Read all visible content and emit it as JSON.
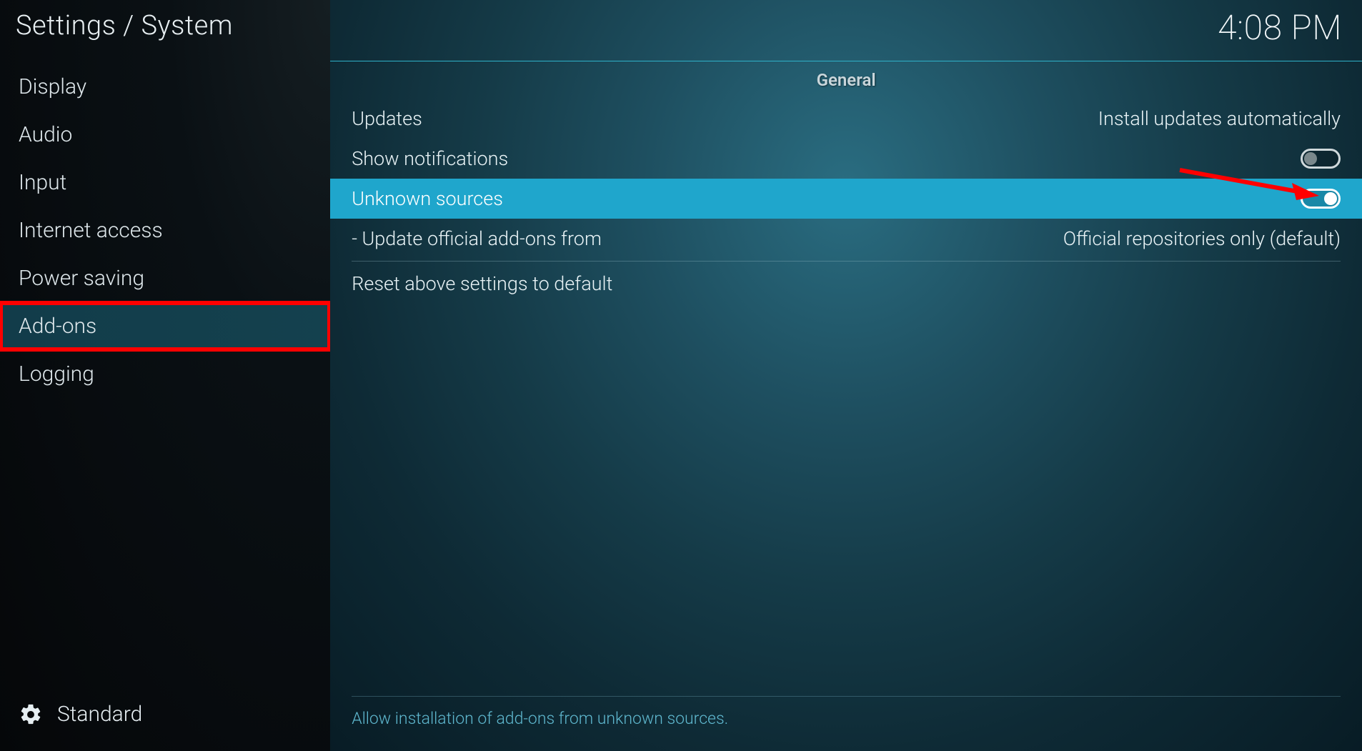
{
  "header": {
    "breadcrumb": "Settings / System",
    "clock": "4:08 PM"
  },
  "sidebar": {
    "items": [
      {
        "label": "Display"
      },
      {
        "label": "Audio"
      },
      {
        "label": "Input"
      },
      {
        "label": "Internet access"
      },
      {
        "label": "Power saving"
      },
      {
        "label": "Add-ons",
        "selected": true,
        "highlighted": true
      },
      {
        "label": "Logging"
      }
    ],
    "level_label": "Standard"
  },
  "main": {
    "section_title": "General",
    "rows": {
      "updates": {
        "label": "Updates",
        "value": "Install updates automatically"
      },
      "notifications": {
        "label": "Show notifications",
        "toggle": "off"
      },
      "unknown": {
        "label": "Unknown sources",
        "toggle": "on",
        "selected": true
      },
      "official": {
        "label": "- Update official add-ons from",
        "value": "Official repositories only (default)"
      },
      "reset": {
        "label": "Reset above settings to default"
      }
    },
    "hint": "Allow installation of add-ons from unknown sources."
  }
}
